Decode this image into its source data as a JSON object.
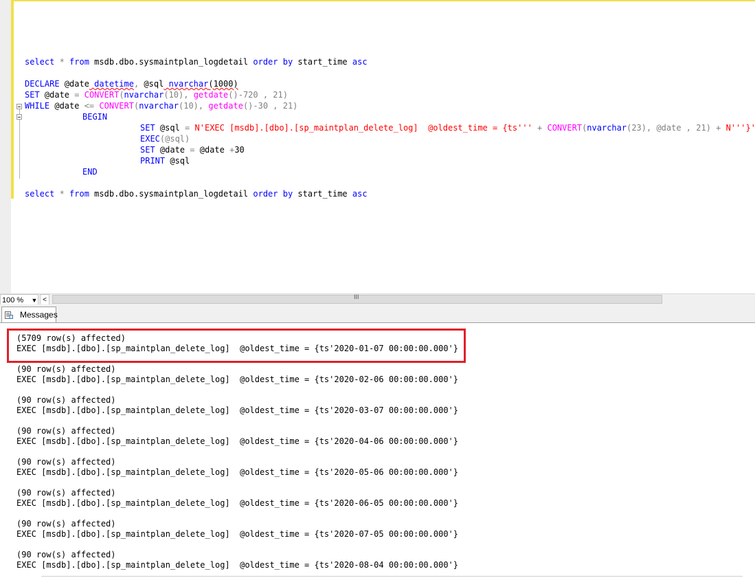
{
  "editor": {
    "lines": {
      "l1": {
        "t1": "select",
        "t2": " * ",
        "t3": "from",
        "t4": " msdb.dbo.sysmaintplan_logdetail ",
        "t5": "order by",
        "t6": " start_time ",
        "t7": "asc"
      },
      "l2": {
        "t1": "DECLARE",
        "t2": " ",
        "t3": "@date",
        "t4": " ",
        "t5": "datetime",
        "t6": ", ",
        "t7": "@sql",
        "t8": " ",
        "t9": "nvarchar",
        "t10": "(1000)"
      },
      "l3": {
        "t1": "SET",
        "t2": " @date ",
        "t3": "=",
        "t4": " ",
        "t5": "CONVERT",
        "t6": "(",
        "t7": "nvarchar",
        "t8": "(10), ",
        "t9": "getdate",
        "t10": "()-720 , 21)"
      },
      "l4": {
        "t1": "WHILE",
        "t2": " @date ",
        "t3": "<=",
        "t4": " ",
        "t5": "CONVERT",
        "t6": "(",
        "t7": "nvarchar",
        "t8": "(10), ",
        "t9": "getdate",
        "t10": "()-30 , 21)"
      },
      "l5": {
        "t1": "BEGIN"
      },
      "l6": {
        "t1": "SET",
        "t2": " @sql ",
        "t3": "=",
        "t4": " ",
        "t5": "N'EXEC [msdb].[dbo].[sp_maintplan_delete_log]  @oldest_time = {ts''' ",
        "t6": "+",
        "t7": " ",
        "t8": "CONVERT",
        "t9": "(",
        "t10": "nvarchar",
        "t11": "(23), @date , 21) ",
        "t12": "+",
        "t13": " ",
        "t14": "N'''}'"
      },
      "l7": {
        "t1": "EXEC",
        "t2": "(@sql)"
      },
      "l8": {
        "t1": "SET",
        "t2": " @date ",
        "t3": "=",
        "t4": " @date ",
        "t5": "+",
        "t6": "30"
      },
      "l9": {
        "t1": "PRINT",
        "t2": " @sql"
      },
      "l10": {
        "t1": "END"
      },
      "l11": {
        "t1": "select",
        "t2": " * ",
        "t3": "from",
        "t4": " msdb.dbo.sysmaintplan_logdetail ",
        "t5": "order by",
        "t6": " start_time ",
        "t7": "asc"
      }
    }
  },
  "statusbar": {
    "zoom": "100 %",
    "zoom_arrow": "▼",
    "scroll_left": "<",
    "scroll_grip": "III"
  },
  "results": {
    "tab_label": "Messages",
    "tab_icon": "messages-icon",
    "messages": [
      "(5709 row(s) affected)",
      "EXEC [msdb].[dbo].[sp_maintplan_delete_log]  @oldest_time = {ts'2020-01-07 00:00:00.000'}",
      "(90 row(s) affected)",
      "EXEC [msdb].[dbo].[sp_maintplan_delete_log]  @oldest_time = {ts'2020-02-06 00:00:00.000'}",
      "(90 row(s) affected)",
      "EXEC [msdb].[dbo].[sp_maintplan_delete_log]  @oldest_time = {ts'2020-03-07 00:00:00.000'}",
      "(90 row(s) affected)",
      "EXEC [msdb].[dbo].[sp_maintplan_delete_log]  @oldest_time = {ts'2020-04-06 00:00:00.000'}",
      "(90 row(s) affected)",
      "EXEC [msdb].[dbo].[sp_maintplan_delete_log]  @oldest_time = {ts'2020-05-06 00:00:00.000'}",
      "(90 row(s) affected)",
      "EXEC [msdb].[dbo].[sp_maintplan_delete_log]  @oldest_time = {ts'2020-06-05 00:00:00.000'}",
      "(90 row(s) affected)",
      "EXEC [msdb].[dbo].[sp_maintplan_delete_log]  @oldest_time = {ts'2020-07-05 00:00:00.000'}",
      "(90 row(s) affected)",
      "EXEC [msdb].[dbo].[sp_maintplan_delete_log]  @oldest_time = {ts'2020-08-04 00:00:00.000'}"
    ]
  },
  "colors": {
    "keyword": "#0000ff",
    "function": "#ff00ff",
    "string": "#ff0000",
    "operator": "#808080",
    "highlight_box": "#e0202a",
    "change_bar": "#f0e14a"
  }
}
